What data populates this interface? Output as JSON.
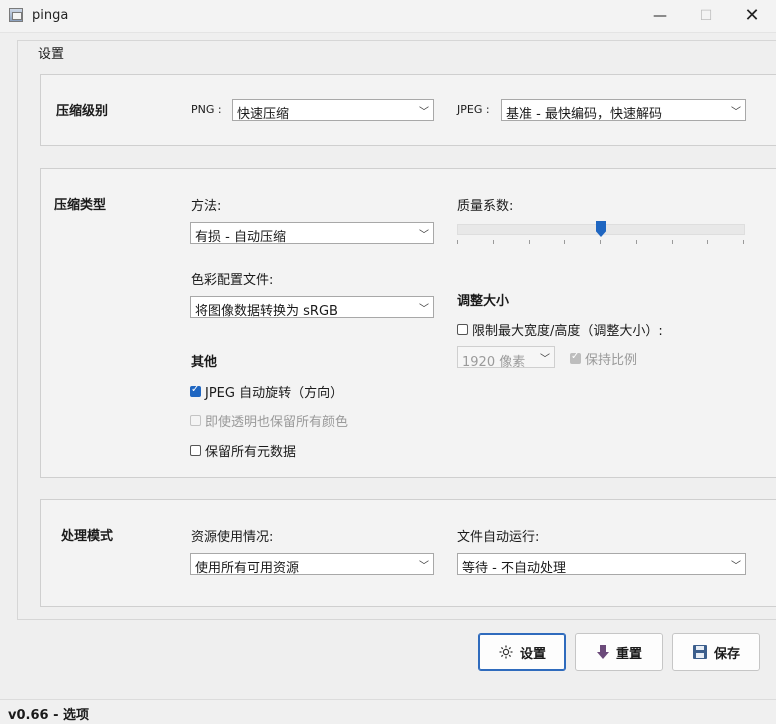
{
  "window": {
    "title": "pinga",
    "icon": "app-window-icon"
  },
  "group_title": "设置",
  "compression_level": {
    "title": "压缩级别",
    "png_label": "PNG :",
    "png_value": "快速压缩",
    "jpeg_label": "JPEG :",
    "jpeg_value": "基准 - 最快编码，快速解码"
  },
  "compression_type": {
    "title": "压缩类型",
    "method_label": "方法:",
    "method_value": "有损 - 自动压缩",
    "color_profile_label": "色彩配置文件:",
    "color_profile_value": "将图像数据转换为 sRGB",
    "quality_label": "质量系数:",
    "quality_slider_position": 0.5,
    "other_title": "其他",
    "options": [
      {
        "label": "JPEG 自动旋转（方向）",
        "checked": true,
        "enabled": true
      },
      {
        "label": "即使透明也保留所有颜色",
        "checked": false,
        "enabled": false
      },
      {
        "label": "保留所有元数据",
        "checked": false,
        "enabled": true
      }
    ],
    "resize_title": "调整大小",
    "limit_size_label": "限制最大宽度/高度（调整大小）:",
    "limit_size_checked": false,
    "size_value": "1920 像素",
    "keep_ratio_label": "保持比例",
    "keep_ratio_checked": true
  },
  "processing_mode": {
    "title": "处理模式",
    "resource_label": "资源使用情况:",
    "resource_value": "使用所有可用资源",
    "auto_run_label": "文件自动运行:",
    "auto_run_value": "等待 - 不自动处理"
  },
  "buttons": {
    "settings": "设置",
    "reset": "重置",
    "save": "保存"
  },
  "status": "v0.66 - 选项",
  "colors": {
    "accent": "#1f66c1",
    "reset_arrow": "#6b4a7a",
    "save_icon": "#3c5e8c"
  }
}
